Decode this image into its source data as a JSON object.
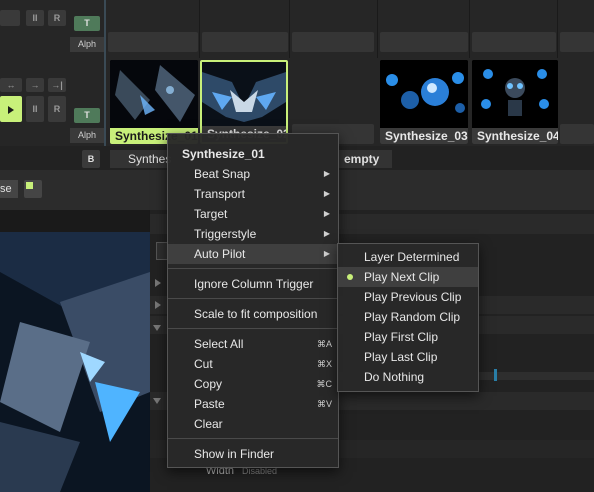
{
  "layer_controls": {
    "t_label": "T",
    "alph_label": "Alph",
    "pause_glyph": "II",
    "r_label": "R",
    "b_label": "B",
    "transport_icons": [
      "↔",
      "→",
      "→|"
    ]
  },
  "clips": [
    {
      "name": "Synthesize_01",
      "selected": true
    },
    {
      "name": "Synthesize_02",
      "selected": false
    },
    {
      "name": "Synthesize_03",
      "selected": false
    },
    {
      "name": "Synthesize_04",
      "selected": false
    }
  ],
  "column_bar": {
    "items": [
      "Synthes",
      "empty"
    ]
  },
  "left_tab": {
    "label": "se"
  },
  "params": {
    "width_label": "Width",
    "width_value": "Disabled"
  },
  "context_menu": {
    "title": "Synthesize_01",
    "items": [
      {
        "label": "Beat Snap",
        "submenu": true
      },
      {
        "label": "Transport",
        "submenu": true
      },
      {
        "label": "Target",
        "submenu": true
      },
      {
        "label": "Triggerstyle",
        "submenu": true
      },
      {
        "label": "Auto Pilot",
        "submenu": true
      },
      {
        "label": "Ignore Column Trigger"
      },
      {
        "label": "Scale to fit composition"
      },
      {
        "label": "Select All",
        "shortcut": "⌘A"
      },
      {
        "label": "Cut",
        "shortcut": "⌘X"
      },
      {
        "label": "Copy",
        "shortcut": "⌘C"
      },
      {
        "label": "Paste",
        "shortcut": "⌘V"
      },
      {
        "label": "Clear"
      },
      {
        "label": "Show in Finder"
      }
    ]
  },
  "auto_pilot_submenu": {
    "items": [
      "Layer Determined",
      "Play Next Clip",
      "Play Previous Clip",
      "Play Random Clip",
      "Play First Clip",
      "Play Last Clip",
      "Do Nothing"
    ],
    "checked": "Play Next Clip"
  },
  "colors": {
    "accent": "#c8f07a",
    "t_button": "#4f7a5a",
    "menu_bg": "#282828"
  }
}
